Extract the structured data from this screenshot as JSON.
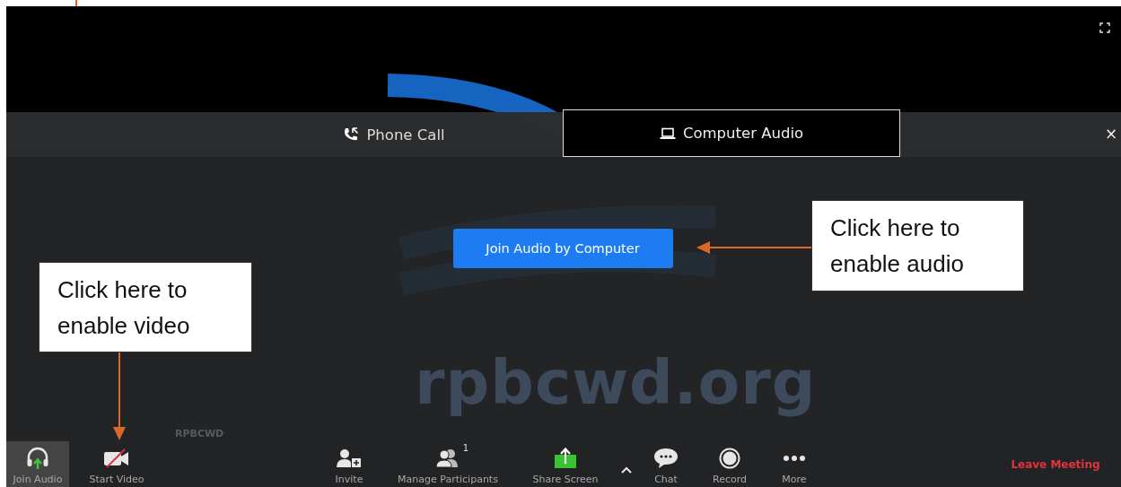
{
  "background": {
    "logo_text": "rpbcwd.org"
  },
  "participant_name": "RPBCWD",
  "audio_dialog": {
    "tabs": [
      {
        "kind": "phone",
        "label": "Phone Call",
        "selected": false
      },
      {
        "kind": "computer",
        "label": "Computer Audio",
        "selected": true
      }
    ],
    "close": "×",
    "join_button": "Join Audio by Computer"
  },
  "toolbar": [
    {
      "kind": "audio",
      "label": "Join Audio",
      "highlighted": true
    },
    {
      "kind": "video",
      "label": "Start Video",
      "highlighted": false
    },
    {
      "kind": "invite",
      "label": "Invite",
      "highlighted": false
    },
    {
      "kind": "participants",
      "label": "Manage Participants",
      "badge": "1",
      "highlighted": false
    },
    {
      "kind": "share",
      "label": "Share Screen",
      "highlighted": false
    },
    {
      "kind": "caret"
    },
    {
      "kind": "chat",
      "label": "Chat",
      "highlighted": false
    },
    {
      "kind": "record",
      "label": "Record",
      "highlighted": false
    },
    {
      "kind": "more",
      "label": "More",
      "highlighted": false
    },
    {
      "kind": "leave",
      "label": "Leave Meeting"
    }
  ],
  "annotations": [
    {
      "text": "Click here to enable video"
    },
    {
      "text": "Click here to enable audio"
    }
  ]
}
